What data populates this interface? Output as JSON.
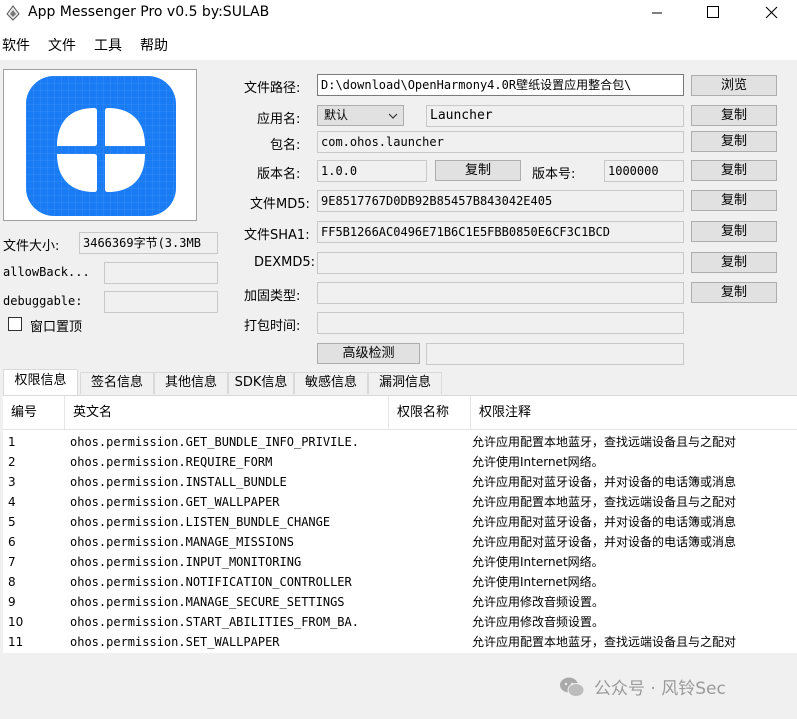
{
  "window": {
    "title": "App Messenger Pro v0.5   by:SULAB"
  },
  "menu": [
    "软件",
    "文件",
    "工具",
    "帮助"
  ],
  "info": {
    "file_size_label": "文件大小:",
    "file_size_value": "3466369字节(3.3MB",
    "allowbackup_label": "allowBack...",
    "allowbackup_value": "",
    "debuggable_label": "debuggable:",
    "debuggable_value": "",
    "on_top_label": "窗口置顶"
  },
  "form": {
    "path_label": "文件路径:",
    "path_value": "D:\\download\\OpenHarmony4.0R壁纸设置应用整合包\\",
    "browse_label": "浏览",
    "appname_label": "应用名:",
    "appname_select": "默认",
    "appname_value": "Launcher",
    "pkg_label": "包名:",
    "pkg_value": "com.ohos.launcher",
    "vername_label": "版本名:",
    "vername_value": "1.0.0",
    "vercode_label": "版本号:",
    "vercode_value": "1000000",
    "md5_label": "文件MD5:",
    "md5_value": "9E8517767D0DB92B85457B843042E405",
    "sha1_label": "文件SHA1:",
    "sha1_value": "FF5B1266AC0496E71B6C1E5FBB0850E6CF3C1BCD",
    "dexmd5_label": "DEXMD5:",
    "dexmd5_value": "",
    "protect_label": "加固类型:",
    "protect_value": "",
    "packtime_label": "打包时间:",
    "packtime_value": "",
    "copy_label": "复制",
    "advanced_label": "高级检测",
    "advanced_value": ""
  },
  "tabs": [
    "权限信息",
    "签名信息",
    "其他信息",
    "SDK信息",
    "敏感信息",
    "漏洞信息"
  ],
  "table": {
    "columns": [
      "编号",
      "英文名",
      "权限名称",
      "权限注释"
    ],
    "rows": [
      [
        "1",
        "ohos.permission.GET_BUNDLE_INFO_PRIVILE.",
        "",
        "允许应用配置本地蓝牙，查找远端设备且与之配对"
      ],
      [
        "2",
        "ohos.permission.REQUIRE_FORM",
        "",
        "允许使用Internet网络。"
      ],
      [
        "3",
        "ohos.permission.INSTALL_BUNDLE",
        "",
        "允许应用配对蓝牙设备，并对设备的电话簿或消息"
      ],
      [
        "4",
        "ohos.permission.GET_WALLPAPER",
        "",
        "允许应用配置本地蓝牙，查找远端设备且与之配对"
      ],
      [
        "5",
        "ohos.permission.LISTEN_BUNDLE_CHANGE",
        "",
        "允许应用配对蓝牙设备，并对设备的电话簿或消息"
      ],
      [
        "6",
        "ohos.permission.MANAGE_MISSIONS",
        "",
        "允许应用配对蓝牙设备，并对设备的电话簿或消息"
      ],
      [
        "7",
        "ohos.permission.INPUT_MONITORING",
        "",
        "允许使用Internet网络。"
      ],
      [
        "8",
        "ohos.permission.NOTIFICATION_CONTROLLER",
        "",
        "允许使用Internet网络。"
      ],
      [
        "9",
        "ohos.permission.MANAGE_SECURE_SETTINGS",
        "",
        "允许应用修改音频设置。"
      ],
      [
        "10",
        "ohos.permission.START_ABILITIES_FROM_BA.",
        "",
        "允许应用修改音频设置。"
      ],
      [
        "11",
        "ohos.permission.SET_WALLPAPER",
        "",
        "允许应用配置本地蓝牙，查找远端设备且与之配对"
      ]
    ]
  },
  "watermark": "公众号 · 风铃Sec",
  "colors": {
    "logo_blue": "#1a7cf5",
    "window_bg": "#f0f0f0"
  }
}
